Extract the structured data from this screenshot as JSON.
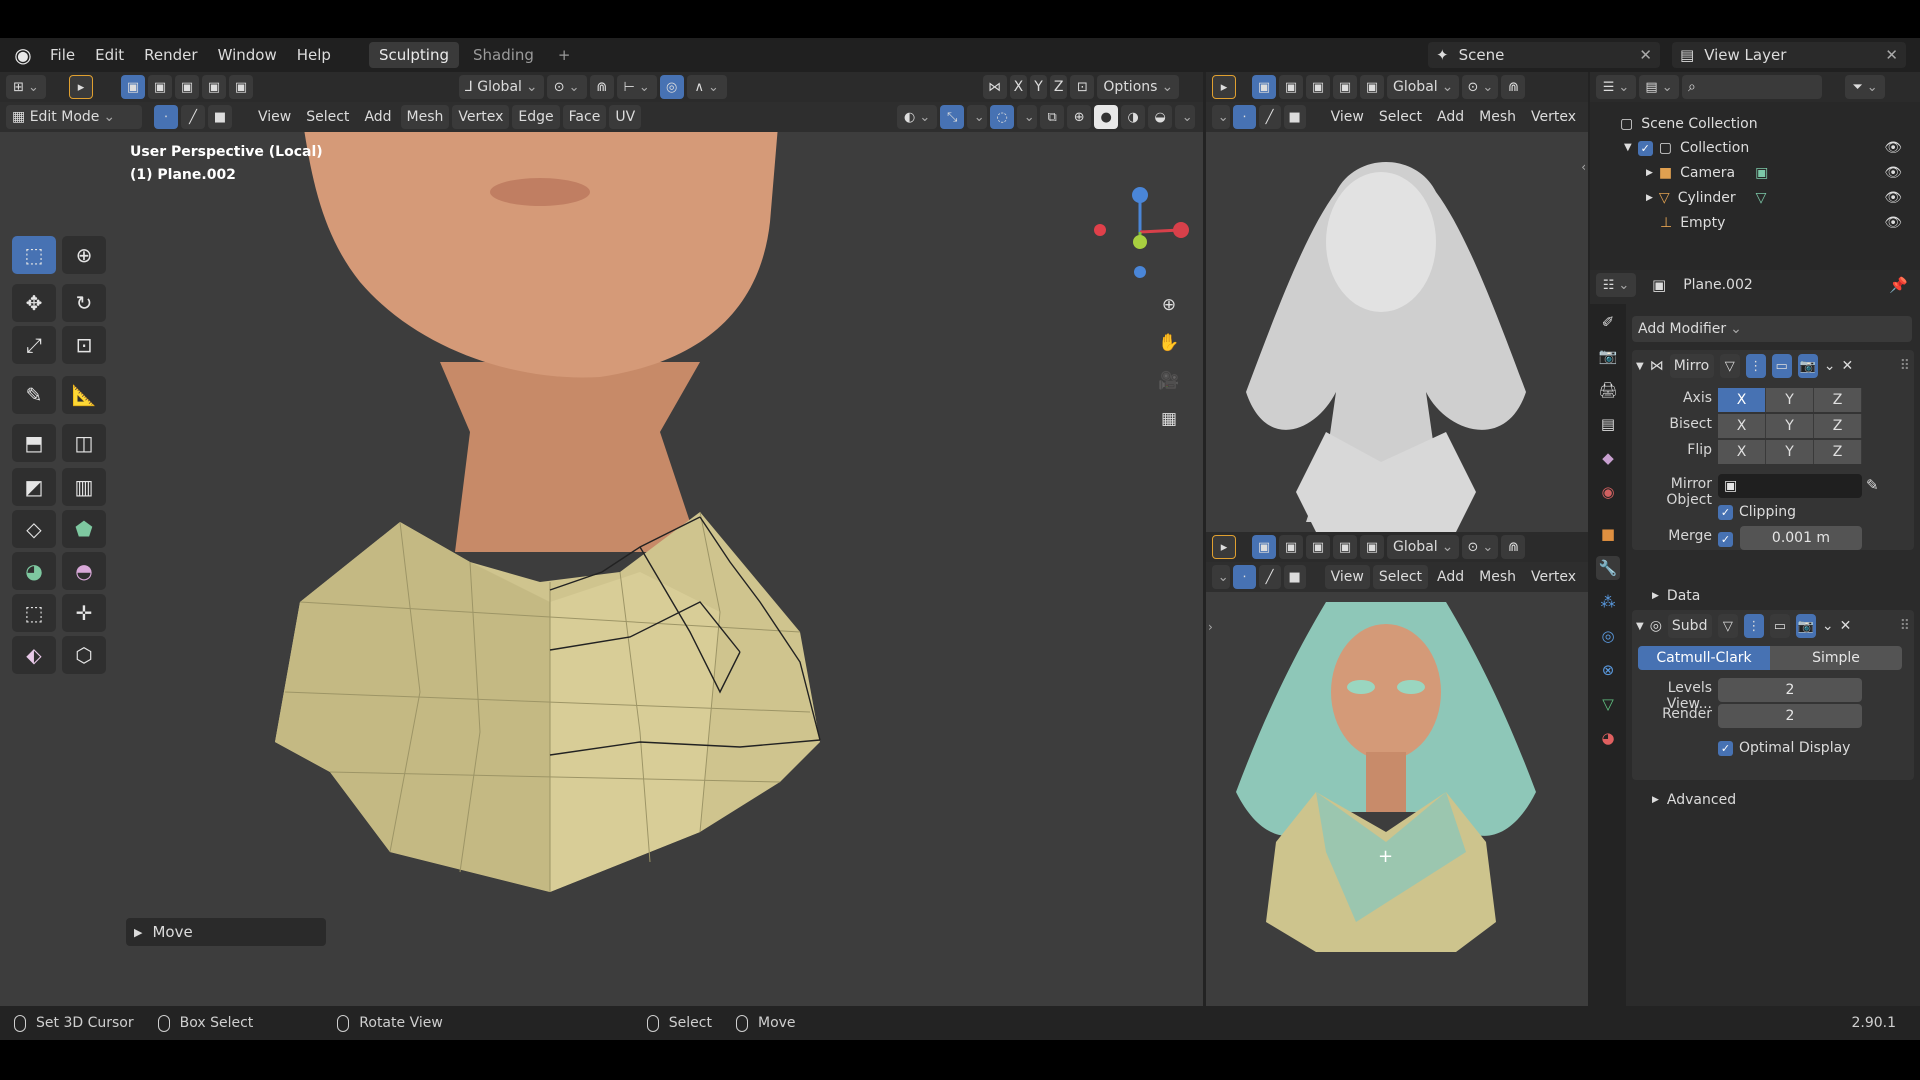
{
  "topbar": {
    "menus": [
      "File",
      "Edit",
      "Render",
      "Window",
      "Help"
    ],
    "workspaces": [
      "Sculpting",
      "Shading"
    ],
    "active_workspace": "Sculpting",
    "add_workspace": "+",
    "scene": "Scene",
    "view_layer": "View Layer"
  },
  "main_header": {
    "orientation": "Global",
    "options": "Options",
    "axes": [
      "X",
      "Y",
      "Z"
    ]
  },
  "main_header2": {
    "mode": "Edit Mode",
    "menus": [
      "View",
      "Select",
      "Add",
      "Mesh",
      "Vertex",
      "Edge",
      "Face",
      "UV"
    ]
  },
  "viewport_main": {
    "perspective": "User Perspective (Local)",
    "object": "(1) Plane.002",
    "last_op": "Move"
  },
  "viewport_small": {
    "orientation": "Global",
    "menus": [
      "View",
      "Select",
      "Add",
      "Mesh",
      "Vertex"
    ]
  },
  "outliner": {
    "scene_collection": "Scene Collection",
    "collection": "Collection",
    "items": [
      "Camera",
      "Cylinder",
      "Empty"
    ]
  },
  "properties": {
    "object_name": "Plane.002",
    "add_modifier": "Add Modifier",
    "mirror": {
      "name": "Mirro",
      "axis_label": "Axis",
      "bisect_label": "Bisect",
      "flip_label": "Flip",
      "mirror_object_label": "Mirror Object",
      "clipping_label": "Clipping",
      "merge_label": "Merge",
      "merge_value": "0.001 m",
      "data_label": "Data"
    },
    "subsurf": {
      "name": "Subd",
      "catmull": "Catmull-Clark",
      "simple": "Simple",
      "levels_label": "Levels View...",
      "levels_value": "2",
      "render_label": "Render",
      "render_value": "2",
      "optimal_label": "Optimal Display",
      "advanced_label": "Advanced"
    }
  },
  "status": {
    "items": [
      "Set 3D Cursor",
      "Box Select",
      "Rotate View",
      "Select",
      "Move"
    ],
    "version": "2.90.1"
  },
  "colors": {
    "accent": "#4772b3",
    "skin": "#d49a78",
    "shirt": "#c9c08a",
    "hair": "#8fc6b8",
    "clay": "#d2d2d2"
  }
}
